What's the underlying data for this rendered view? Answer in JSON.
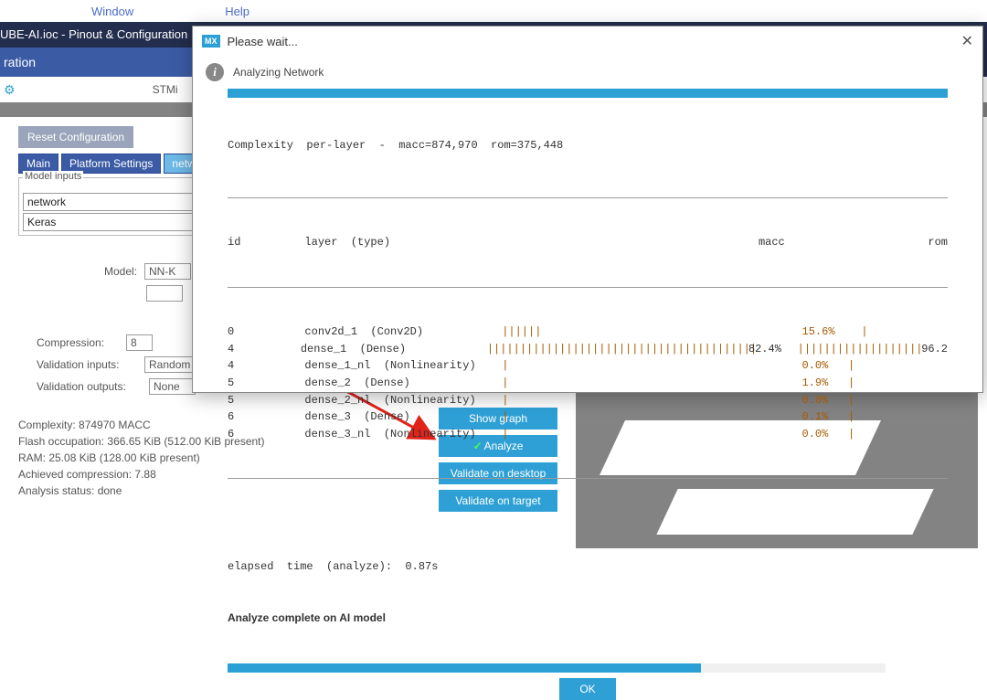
{
  "menu": {
    "window": "Window",
    "help": "Help"
  },
  "titlebar": "UBE-AI.ioc - Pinout & Configuration",
  "subtitle": "ration",
  "stmi_text": "STMi",
  "reset_btn": "Reset Configuration",
  "tabs": {
    "main": "Main",
    "platform": "Platform Settings",
    "network": "netwo"
  },
  "model_inputs": {
    "legend": "Model inputs",
    "network": "network",
    "keras": "Keras"
  },
  "model_label": "Model:",
  "model_value": "NN-K",
  "form": {
    "compression_label": "Compression:",
    "compression_value": "8",
    "vin_label": "Validation inputs:",
    "vin_value": "Random numbers",
    "vout_label": "Validation outputs:",
    "vout_value": "None"
  },
  "stats": {
    "complexity": "Complexity:  874970 MACC",
    "flash": "Flash occupation: 366.65 KiB (512.00 KiB present)",
    "ram": "RAM: 25.08 KiB (128.00 KiB present)",
    "achieved": "Achieved compression: 7.88",
    "status": "Analysis status: done"
  },
  "actions": {
    "show_graph": "Show graph",
    "analyze": "Analyze",
    "val_desktop": "Validate on desktop",
    "val_target": "Validate on target"
  },
  "modal": {
    "title": "Please wait...",
    "analyzing": "Analyzing Network",
    "header_line": "Complexity  per-layer  -  macc=874,970  rom=375,448",
    "col_id": "id",
    "col_layer": "layer  (type)",
    "col_macc": "macc",
    "col_rom": "rom",
    "rows": [
      {
        "id": "0",
        "layer": "conv2d_1  (Conv2D)",
        "bar1": "||||||",
        "macc": "",
        "bar2": "15.6%    |",
        "rom": ""
      },
      {
        "id": "4",
        "layer": "dense_1  (Dense)",
        "bar1": "|||||||||||||||||||||||||||||||||||||||||",
        "macc": "82.4%",
        "bar2": "|||||||||||||||||||",
        "rom": "96.2"
      },
      {
        "id": "4",
        "layer": "dense_1_nl  (Nonlinearity)",
        "bar1": "|",
        "macc": "",
        "bar2": "0.0%   |",
        "rom": ""
      },
      {
        "id": "5",
        "layer": "dense_2  (Dense)",
        "bar1": "|",
        "macc": "",
        "bar2": "1.9%   |",
        "rom": ""
      },
      {
        "id": "5",
        "layer": "dense_2_nl  (Nonlinearity)",
        "bar1": "|",
        "macc": "",
        "bar2": "0.0%   |",
        "rom": ""
      },
      {
        "id": "6",
        "layer": "dense_3  (Dense)",
        "bar1": "|",
        "macc": "",
        "bar2": "0.1%   |",
        "rom": ""
      },
      {
        "id": "6",
        "layer": "dense_3_nl  (Nonlinearity)",
        "bar1": "|",
        "macc": "",
        "bar2": "0.0%   |",
        "rom": ""
      }
    ],
    "elapsed": "elapsed  time  (analyze):  0.87s",
    "complete": "Analyze complete on AI model",
    "ok": "OK"
  }
}
